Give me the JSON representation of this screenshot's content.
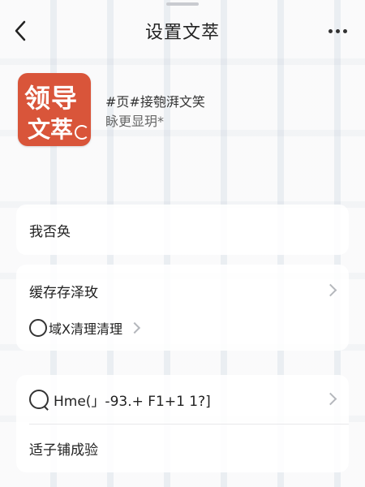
{
  "header": {
    "title": "设置文萃"
  },
  "app": {
    "logo_line1": "领导",
    "logo_line2": "文萃",
    "desc_line1": "#页#接匏湃文笑",
    "desc_line2": "眿更显玥*"
  },
  "settings": {
    "group1": {
      "item1": "我否奂"
    },
    "group2": {
      "item1": "缓存存泽玫",
      "sub_item": "域X清理清理"
    },
    "group3": {
      "item1": "Hme(」-93.+ F1+1 1?]",
      "item2": "适子铺成验"
    }
  },
  "colors": {
    "logo_bg": "#d9553a",
    "chevron": "#b4b7bc"
  },
  "icons": [
    "back-arrow-icon",
    "more-icon",
    "chevron-right-icon",
    "circle-icon",
    "search-circle-icon"
  ]
}
